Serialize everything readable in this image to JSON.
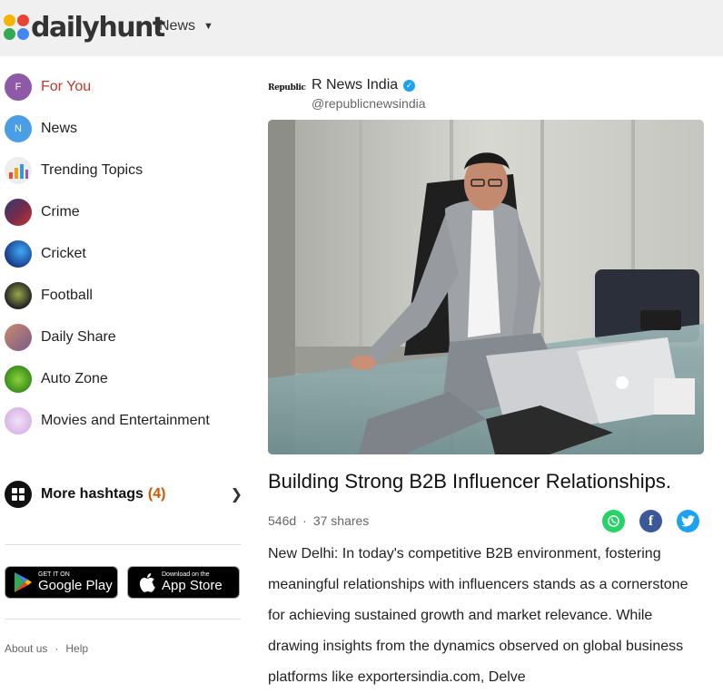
{
  "brand": {
    "name": "dailyhunt"
  },
  "nav": {
    "news_label": "News"
  },
  "sidebar": {
    "items": [
      {
        "label": "For You",
        "avatar_text": "F",
        "active": true
      },
      {
        "label": "News",
        "avatar_text": "N",
        "active": false
      },
      {
        "label": "Trending Topics",
        "active": false
      },
      {
        "label": "Crime",
        "active": false
      },
      {
        "label": "Cricket",
        "active": false
      },
      {
        "label": "Football",
        "active": false
      },
      {
        "label": "Daily Share",
        "active": false
      },
      {
        "label": "Auto Zone",
        "active": false
      },
      {
        "label": "Movies and Entertainment",
        "active": false
      }
    ],
    "more_hashtags": {
      "label": "More hashtags",
      "count": "(4)"
    }
  },
  "stores": {
    "google_play": {
      "small": "GET IT ON",
      "big": "Google Play"
    },
    "app_store": {
      "small": "Download on the",
      "big": "App Store"
    }
  },
  "footer": {
    "about": "About us",
    "help": "Help"
  },
  "article": {
    "publisher_logo_text": "Republic",
    "publisher_name": "R News India",
    "publisher_handle": "@republicnewsindia",
    "headline": "Building Strong B2B Influencer Relationships.",
    "age": "546d",
    "shares": "37 shares",
    "body": "New Delhi: In today's competitive B2B environment, fostering meaningful relationships with influencers stands as a cornerstone for achieving sustained growth and market relevance. While drawing insights from the dynamics observed on global business platforms like exportersindia.com, Delve"
  },
  "colors": {
    "accent_red": "#c0392b",
    "whatsapp": "#25d366",
    "facebook": "#3b5998",
    "twitter": "#1da1f2"
  }
}
